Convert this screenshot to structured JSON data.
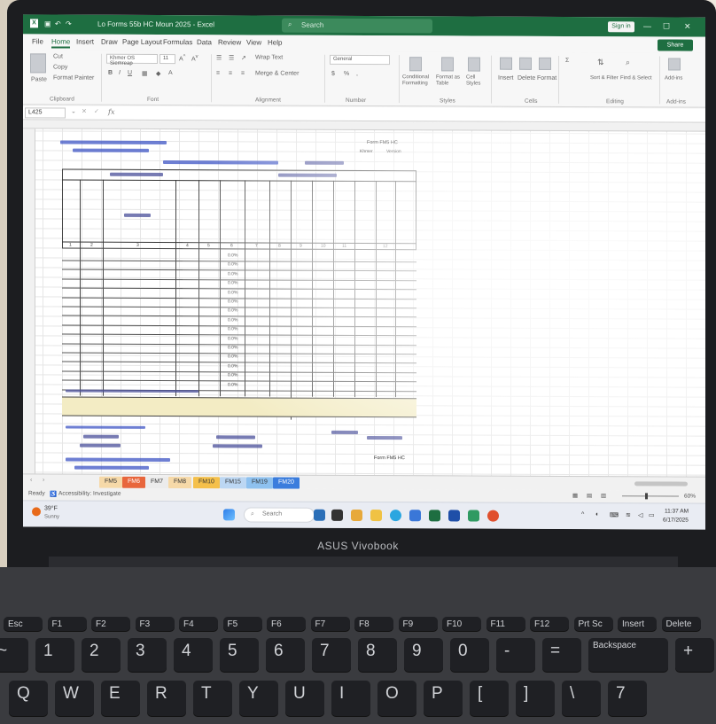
{
  "excel": {
    "title": "Lo Forms 55b HC Moun 2025 - Excel",
    "search_placeholder": "Search",
    "sign_in": "Sign in",
    "share": "Share",
    "menu": [
      "File",
      "Home",
      "Insert",
      "Draw",
      "Page Layout",
      "Formulas",
      "Data",
      "Review",
      "View",
      "Help"
    ],
    "active_menu": "Home",
    "ribbon": {
      "paste": "Paste",
      "cut": "Cut",
      "copy": "Copy",
      "format_painter": "Format Painter",
      "font_name": "Khmer OS Siemreap",
      "font_size": "11",
      "wrap_text": "Wrap Text",
      "merge_center": "Merge & Center",
      "number_format": "General",
      "conditional_formatting": "Conditional Formatting",
      "format_as_table": "Format as Table",
      "cell_styles": "Cell Styles",
      "insert": "Insert",
      "delete": "Delete",
      "format": "Format",
      "sort_filter": "Sort & Filter",
      "find_select": "Find & Select",
      "add_ins": "Add-ins",
      "groups": [
        "Clipboard",
        "Font",
        "Alignment",
        "Number",
        "Styles",
        "Cells",
        "Editing",
        "Add-ins"
      ]
    },
    "name_box": "L425",
    "fx": "fx",
    "form": {
      "form_code": "Form FM5 HC",
      "version_labels": [
        "Khmer",
        "Version"
      ],
      "row_values": [
        "0.0%",
        "0.0%",
        "0.0%",
        "0.0%",
        "0.0%",
        "0.0%",
        "0.0%",
        "0.0%",
        "0.0%",
        "0.0%",
        "0.0%",
        "0.0%",
        "0.0%",
        "0.0%",
        "0.0%"
      ],
      "form_code_bottom": "Form FM5 HC",
      "col_numbers": [
        "1",
        "2",
        "3",
        "4",
        "5",
        "6",
        "7",
        "8",
        "9",
        "10",
        "11",
        "12"
      ]
    },
    "sheet_tabs": [
      "FM5",
      "FM6",
      "FM7",
      "FM8",
      "FM10",
      "FM15",
      "FM19",
      "FM20"
    ],
    "status": {
      "ready": "Ready",
      "accessibility": "Accessibility: Investigate",
      "zoom": "60%"
    }
  },
  "taskbar": {
    "weather_temp": "39°F",
    "weather_text": "Sunny",
    "search_label": "Search",
    "time": "11:37 AM",
    "date": "6/17/2025"
  },
  "laptop": {
    "brand": "ASUS Vivobook",
    "function_keys": [
      "Esc",
      "F1",
      "F2",
      "F3",
      "F4",
      "F5",
      "F6",
      "F7",
      "F8",
      "F9",
      "F10",
      "F11",
      "F12",
      "Prt Sc",
      "Insert",
      "Delete"
    ],
    "number_row": [
      "~",
      "1",
      "2",
      "3",
      "4",
      "5",
      "6",
      "7",
      "8",
      "9",
      "0",
      "-",
      "=",
      "Backspace",
      "+"
    ],
    "letter_row": [
      "Q",
      "W",
      "E",
      "R",
      "T",
      "Y",
      "U",
      "I",
      "O",
      "P",
      "[",
      "]",
      "\\",
      "7"
    ]
  }
}
